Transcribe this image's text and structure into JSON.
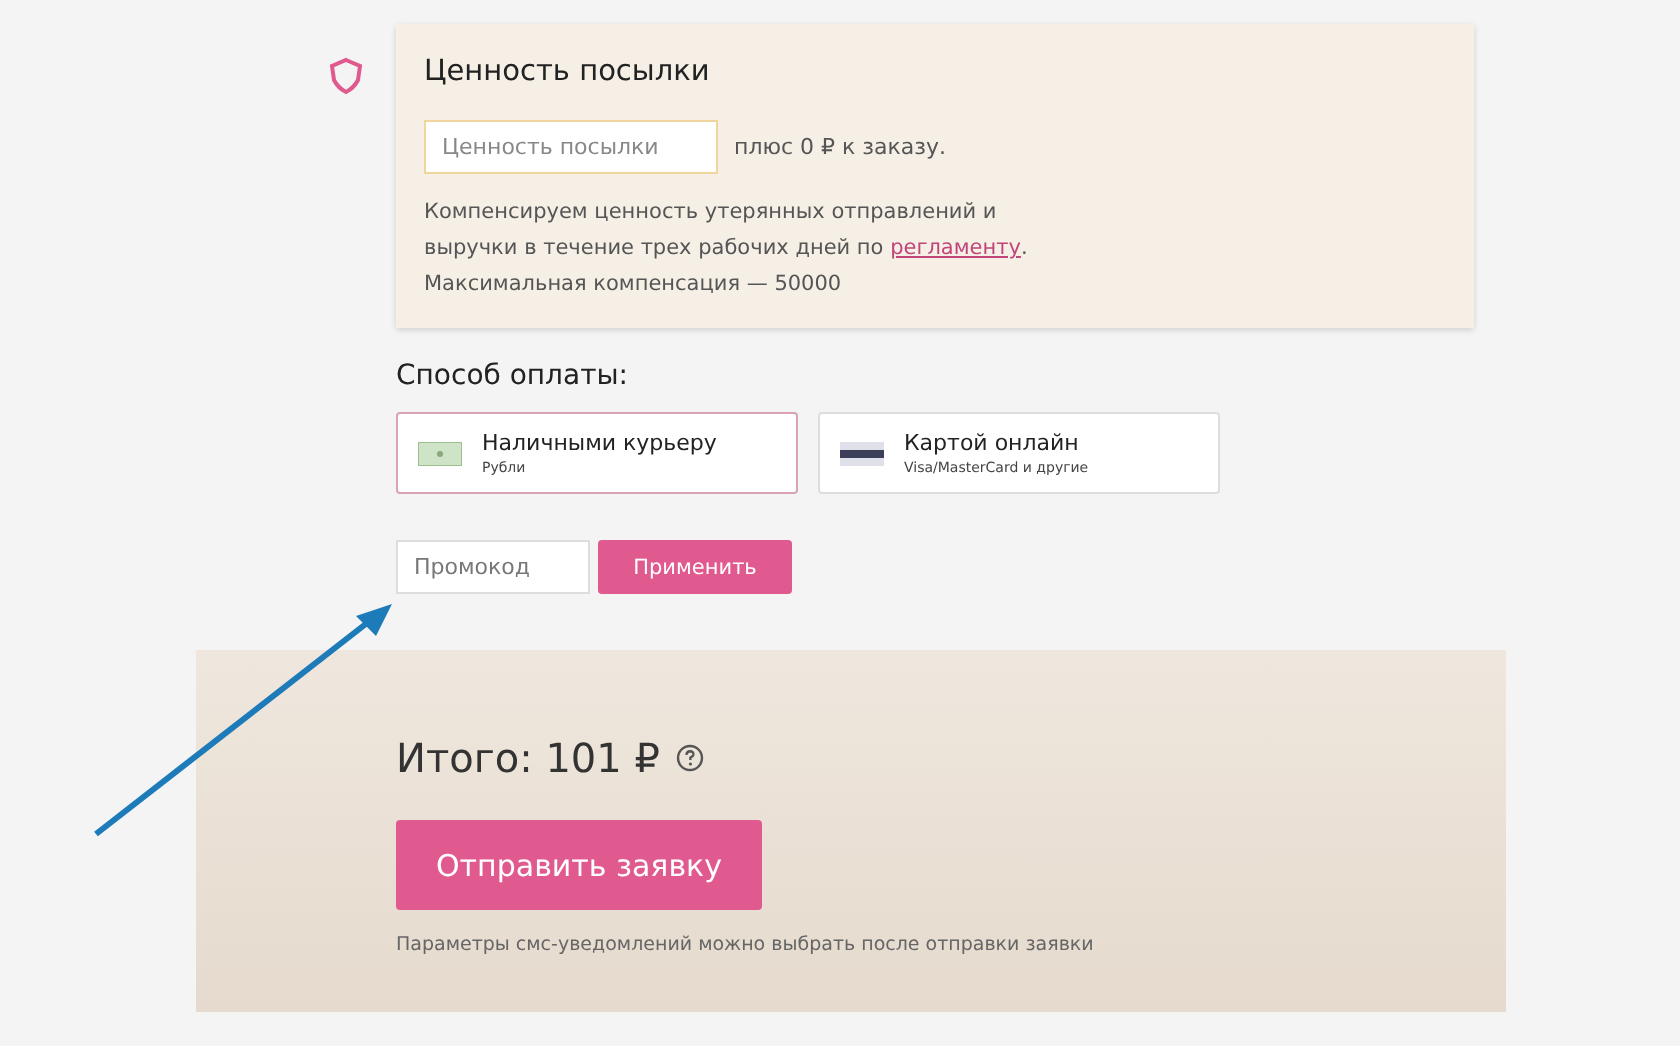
{
  "insurance": {
    "title": "Ценность посылки",
    "value_field": {
      "placeholder": "Ценность посылки"
    },
    "surcharge": "плюс 0 ₽ к заказу.",
    "note_before": "Компенсируем ценность утерянных отправлений и выручки в течение трех рабочих дней по ",
    "note_link": "регламенту",
    "note_after": ". Максимальная компенсация — 50000"
  },
  "payment": {
    "label": "Способ оплаты:",
    "options": [
      {
        "kind": "cash",
        "title": "Наличными курьеру",
        "subtitle": "Рубли",
        "selected": true
      },
      {
        "kind": "card",
        "title": "Картой онлайн",
        "subtitle": "Visa/MasterCard и другие",
        "selected": false
      }
    ]
  },
  "promo": {
    "field": {
      "placeholder": "Промокод"
    },
    "button": "Применить"
  },
  "total": {
    "label": "Итого: 101 ₽",
    "submit": "Отправить заявку",
    "note": "Параметры смс-уведомлений можно выбрать после отправки заявки"
  }
}
